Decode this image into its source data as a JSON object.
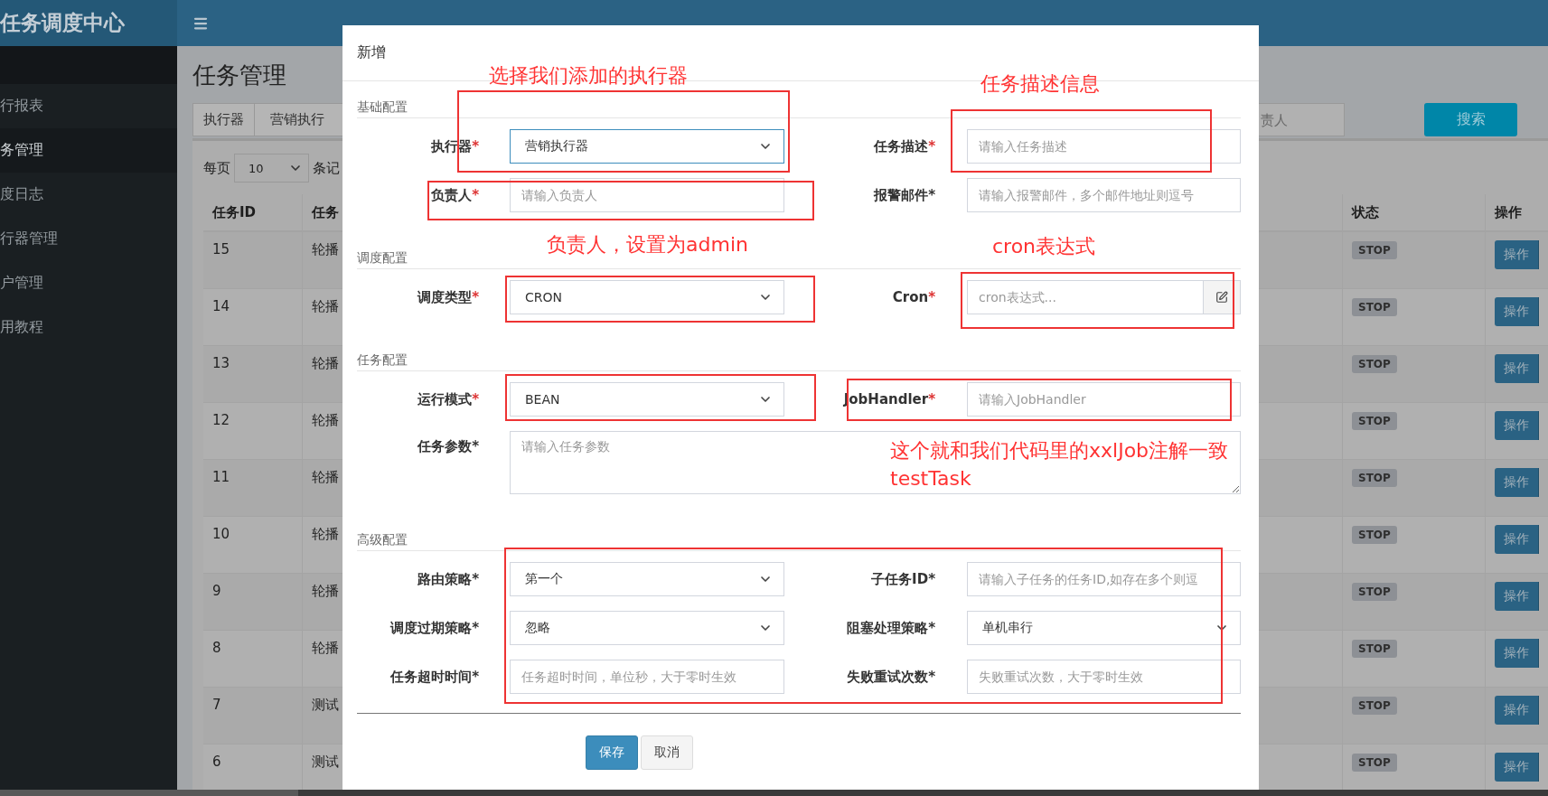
{
  "sidebar": {
    "logo": "任务调度中心",
    "items": [
      {
        "label": "行报表",
        "selected": false
      },
      {
        "label": "务管理",
        "selected": true
      },
      {
        "label": "度日志",
        "selected": false
      },
      {
        "label": "行器管理",
        "selected": false
      },
      {
        "label": "户管理",
        "selected": false
      },
      {
        "label": "用教程",
        "selected": false
      }
    ]
  },
  "page": {
    "title": "任务管理",
    "filters": {
      "label": "执行器",
      "select_value": "营销执行",
      "search_placeholder": "责人",
      "search_button": "搜索"
    },
    "page_size": {
      "prefix": "每页",
      "value": "10",
      "suffix": "条记"
    },
    "table": {
      "columns": [
        "任务ID",
        "任务",
        "状态",
        "操作"
      ],
      "rows": [
        {
          "id": "15",
          "name": "轮播",
          "status": "STOP",
          "action": "操作"
        },
        {
          "id": "14",
          "name": "轮播",
          "status": "STOP",
          "action": "操作"
        },
        {
          "id": "13",
          "name": "轮播",
          "status": "STOP",
          "action": "操作"
        },
        {
          "id": "12",
          "name": "轮播",
          "status": "STOP",
          "action": "操作"
        },
        {
          "id": "11",
          "name": "轮播",
          "status": "STOP",
          "action": "操作"
        },
        {
          "id": "10",
          "name": "轮播",
          "status": "STOP",
          "action": "操作"
        },
        {
          "id": "9",
          "name": "轮播",
          "status": "STOP",
          "action": "操作"
        },
        {
          "id": "8",
          "name": "轮播",
          "status": "STOP",
          "action": "操作"
        },
        {
          "id": "7",
          "name": "测试",
          "status": "STOP",
          "action": "操作"
        },
        {
          "id": "6",
          "name": "测试",
          "status": "STOP",
          "action": "操作"
        }
      ]
    }
  },
  "dialog": {
    "title": "新增",
    "sections": [
      {
        "title": "基础配置",
        "rows": [
          {
            "fields": [
              {
                "label": "执行器",
                "mark": "*",
                "mark_red": true,
                "kind": "select",
                "value": "营销执行器",
                "focused": true
              },
              {
                "label": "任务描述",
                "mark": "*",
                "mark_red": true,
                "kind": "input",
                "placeholder": "请输入任务描述"
              }
            ]
          },
          {
            "fields": [
              {
                "label": "负责人",
                "mark": "*",
                "mark_red": true,
                "kind": "input",
                "placeholder": "请输入负责人"
              },
              {
                "label": "报警邮件",
                "mark": "*",
                "mark_red": false,
                "kind": "input",
                "placeholder": "请输入报警邮件，多个邮件地址则逗号"
              }
            ]
          }
        ]
      },
      {
        "title": "调度配置",
        "rows": [
          {
            "fields": [
              {
                "label": "调度类型",
                "mark": "*",
                "mark_red": true,
                "kind": "select",
                "value": "CRON",
                "focused": false
              },
              {
                "label": "Cron",
                "mark": "*",
                "mark_red": true,
                "kind": "addon_input",
                "placeholder": "cron表达式..."
              }
            ]
          }
        ]
      },
      {
        "title": "任务配置",
        "rows": [
          {
            "fields": [
              {
                "label": "运行模式",
                "mark": "*",
                "mark_red": true,
                "kind": "select",
                "value": "BEAN",
                "focused": false
              },
              {
                "label": "JobHandler",
                "mark": "*",
                "mark_red": true,
                "kind": "input",
                "placeholder": "请输入JobHandler"
              }
            ]
          },
          {
            "fields": [
              {
                "label": "任务参数",
                "mark": "*",
                "mark_red": false,
                "kind": "textarea",
                "placeholder": "请输入任务参数"
              }
            ]
          }
        ]
      },
      {
        "title": "高级配置",
        "rows": [
          {
            "fields": [
              {
                "label": "路由策略",
                "mark": "*",
                "mark_red": false,
                "kind": "select",
                "value": "第一个",
                "focused": false
              },
              {
                "label": "子任务ID",
                "mark": "*",
                "mark_red": false,
                "kind": "input",
                "placeholder": "请输入子任务的任务ID,如存在多个则逗"
              }
            ]
          },
          {
            "fields": [
              {
                "label": "调度过期策略",
                "mark": "*",
                "mark_red": false,
                "kind": "select",
                "value": "忽略",
                "focused": false
              },
              {
                "label": "阻塞处理策略",
                "mark": "*",
                "mark_red": false,
                "kind": "select",
                "value": "单机串行",
                "focused": false
              }
            ]
          },
          {
            "fields": [
              {
                "label": "任务超时时间",
                "mark": "*",
                "mark_red": false,
                "kind": "input",
                "placeholder": "任务超时时间，单位秒，大于零时生效"
              },
              {
                "label": "失败重试次数",
                "mark": "*",
                "mark_red": false,
                "kind": "input",
                "placeholder": "失败重试次数，大于零时生效"
              }
            ]
          }
        ]
      }
    ],
    "buttons": [
      {
        "label": "保存",
        "kind": "primary"
      },
      {
        "label": "取消",
        "kind": "default"
      }
    ]
  },
  "annotations": [
    {
      "kind": "note",
      "text": "选择我们添加的执行器"
    },
    {
      "kind": "note",
      "text": "任务描述信息"
    },
    {
      "kind": "frame"
    },
    {
      "kind": "frame"
    },
    {
      "kind": "frame"
    },
    {
      "kind": "note",
      "text": "负责人，设置为admin"
    },
    {
      "kind": "note",
      "text": "cron表达式"
    },
    {
      "kind": "frame"
    },
    {
      "kind": "frame"
    },
    {
      "kind": "frame"
    },
    {
      "kind": "frame"
    },
    {
      "kind": "note",
      "text": "这个就和我们代码里的xxlJob注解一致"
    },
    {
      "kind": "note",
      "text": "testTask"
    },
    {
      "kind": "frame"
    }
  ]
}
